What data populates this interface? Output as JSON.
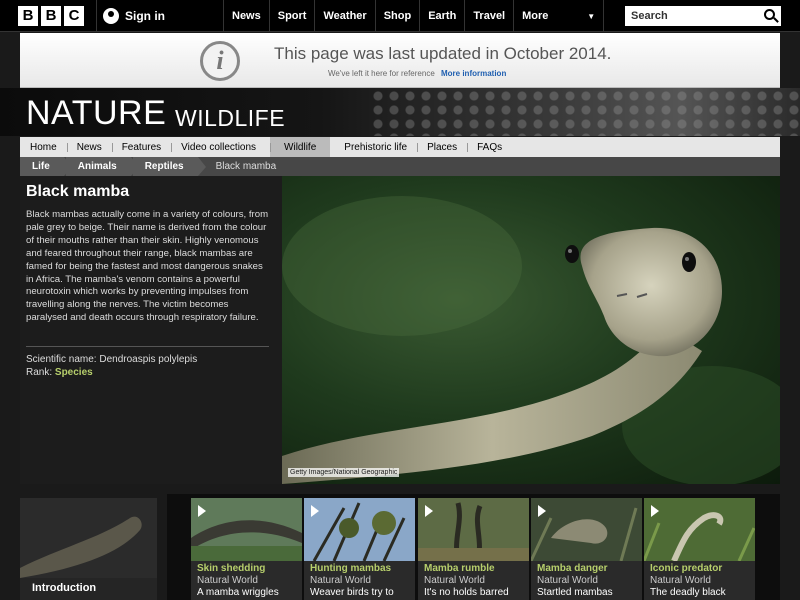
{
  "header": {
    "logo_letters": [
      "B",
      "B",
      "C"
    ],
    "signin_label": "Sign in",
    "nav": [
      "News",
      "Sport",
      "Weather",
      "Shop",
      "Earth",
      "Travel"
    ],
    "more_label": "More",
    "search_placeholder": "Search"
  },
  "notice": {
    "icon_glyph": "i",
    "title": "This page was last updated in October 2014.",
    "subtitle": "We've left it here for reference",
    "link": "More information"
  },
  "brand": {
    "section": "NATURE",
    "subsection": "WILDLIFE"
  },
  "subnav": {
    "items": [
      "Home",
      "News",
      "Features",
      "Video collections",
      "Wildlife",
      "Prehistoric life",
      "Places",
      "FAQs"
    ],
    "active": "Wildlife"
  },
  "breadcrumb": {
    "items": [
      "Life",
      "Animals",
      "Reptiles"
    ],
    "current": "Black mamba"
  },
  "article": {
    "title": "Black mamba",
    "body": "Black mambas actually come in a variety of colours, from pale grey to beige. Their name is derived from the colour of their mouths rather than their skin. Highly venomous and feared throughout their range, black mambas are famed for being the fastest and most dangerous snakes in Africa. The mamba's venom contains a powerful neurotoxin which works by preventing impulses from travelling along the nerves. The victim becomes paralysed and death occurs through respiratory failure.",
    "scientific_label": "Scientific name: Dendroaspis polylepis",
    "rank_label": "Rank: ",
    "rank_value": "Species"
  },
  "image": {
    "credit": "Getty Images/National Geographic"
  },
  "intro": {
    "label": "Introduction"
  },
  "videos": [
    {
      "title": "Skin shedding",
      "source": "Natural World",
      "desc": "A mamba wriggles"
    },
    {
      "title": "Hunting mambas",
      "source": "Natural World",
      "desc": "Weaver birds try to"
    },
    {
      "title": "Mamba rumble",
      "source": "Natural World",
      "desc": "It's no holds barred"
    },
    {
      "title": "Mamba danger",
      "source": "Natural World",
      "desc": "Startled mambas"
    },
    {
      "title": "Iconic predator",
      "source": "Natural World",
      "desc": "The deadly black"
    }
  ],
  "colors": {
    "accent_green": "#b7cf6c",
    "link_blue": "#1f5fb0"
  }
}
